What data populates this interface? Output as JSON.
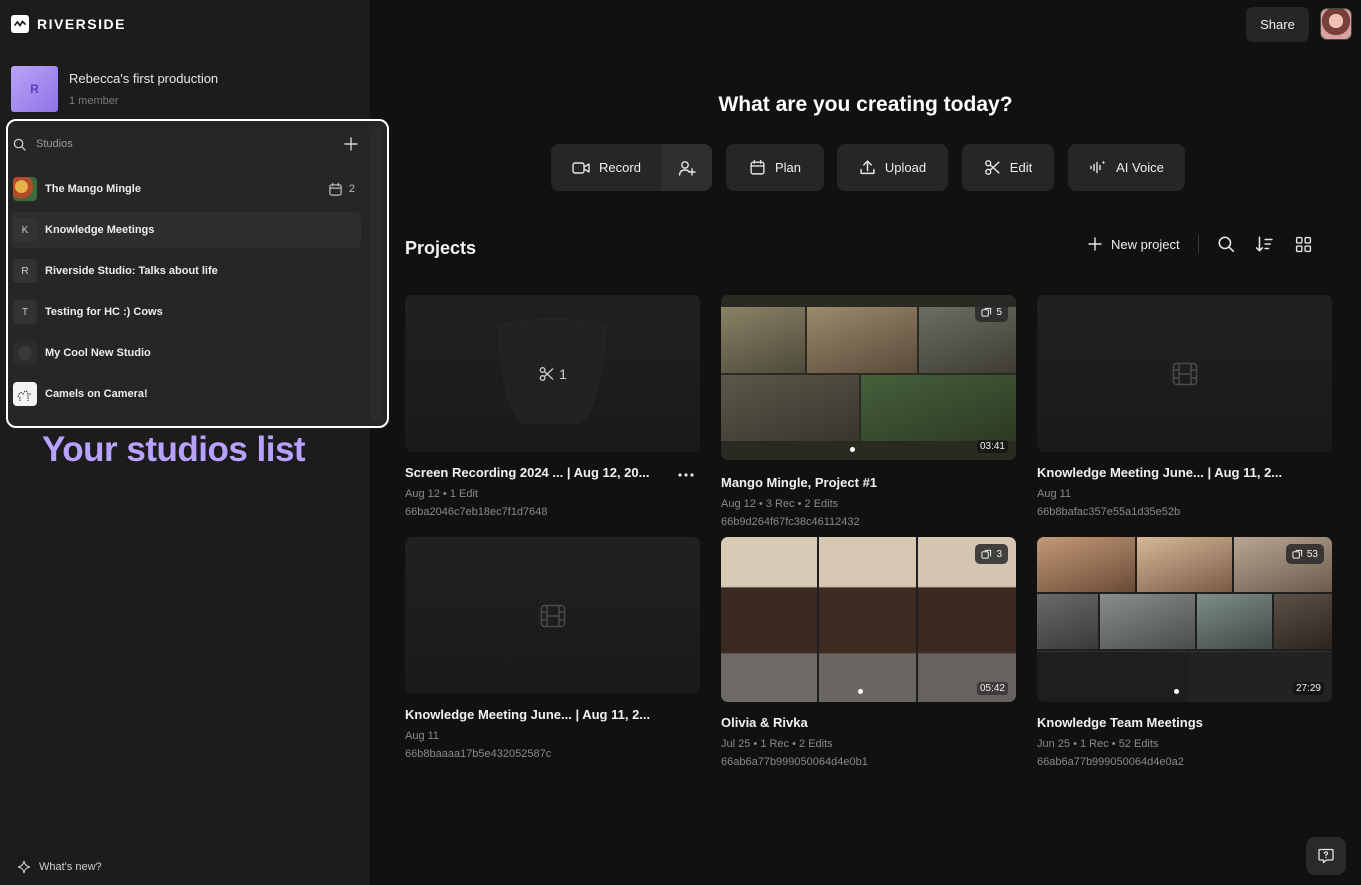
{
  "app": {
    "logo_text": "RIVERSIDE"
  },
  "production": {
    "avatar_letter": "R",
    "name": "Rebecca's first production",
    "members": "1 member"
  },
  "studios": {
    "label": "Studios",
    "items": [
      {
        "name": "The Mango Mingle",
        "icon": "",
        "scheduled_count": "2"
      },
      {
        "name": "Knowledge Meetings",
        "icon": "K"
      },
      {
        "name": "Riverside Studio: Talks about life",
        "icon": "R"
      },
      {
        "name": "Testing for HC :) Cows",
        "icon": "T"
      },
      {
        "name": "My Cool New Studio",
        "icon": ""
      },
      {
        "name": "Camels on Camera!",
        "icon": ""
      }
    ]
  },
  "annotation": "Your studios list",
  "whats_new": "What's new?",
  "header": {
    "share_label": "Share"
  },
  "hero": {
    "title": "What are you creating today?"
  },
  "actions": {
    "record": "Record",
    "plan": "Plan",
    "upload": "Upload",
    "edit": "Edit",
    "ai_voice": "AI Voice"
  },
  "projects": {
    "title": "Projects",
    "new_project": "New project",
    "cards": [
      {
        "title": "Screen Recording 2024 ... | Aug 12, 20...",
        "meta": "Aug 12 • 1 Edit",
        "id": "66ba2046c7eb18ec7f1d7648",
        "center": "1"
      },
      {
        "title": "Mango Mingle, Project #1",
        "meta": "Aug 12 • 3 Rec • 2 Edits",
        "id": "66b9d264f67fc38c46112432",
        "badge": "5",
        "duration": "03:41"
      },
      {
        "title": "Knowledge Meeting June... | Aug 11, 2...",
        "meta": "Aug 11",
        "id": "66b8bafac357e55a1d35e52b"
      },
      {
        "title": "Knowledge Meeting June... | Aug 11, 2...",
        "meta": "Aug 11",
        "id": "66b8baaaa17b5e432052587c"
      },
      {
        "title": "Olivia & Rivka",
        "meta": "Jul 25 • 1 Rec • 2 Edits",
        "id": "66ab6a77b999050064d4e0b1",
        "badge": "3",
        "duration": "05:42"
      },
      {
        "title": "Knowledge Team Meetings",
        "meta": "Jun 25 • 1 Rec • 52 Edits",
        "id": "66ab6a77b999050064d4e0a2",
        "badge": "53",
        "duration": "27:29"
      }
    ]
  },
  "colors": {
    "background": "#111111",
    "sidebar": "#1c1c1c",
    "accent": "#b8a2ff",
    "highlight_border": "#ffffff"
  }
}
